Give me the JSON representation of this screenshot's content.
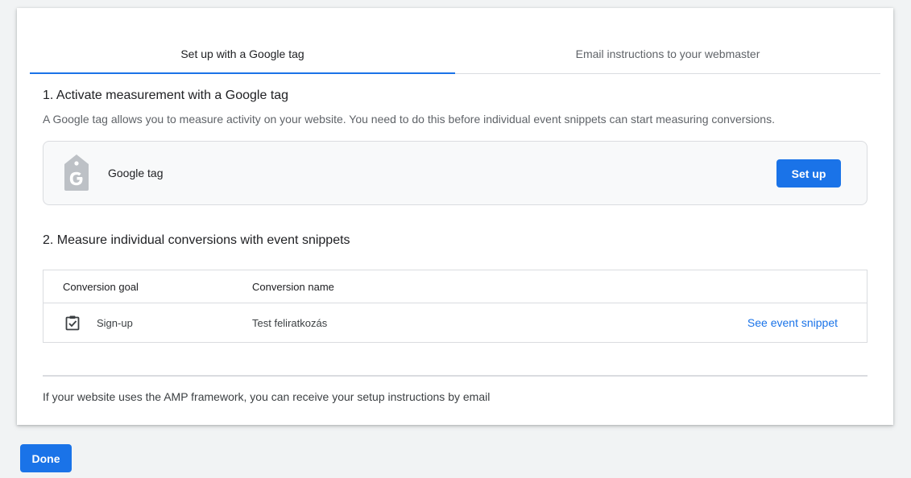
{
  "tabs": [
    {
      "label": "Set up with a Google tag",
      "active": true
    },
    {
      "label": "Email instructions to your webmaster",
      "active": false
    }
  ],
  "section1": {
    "heading": "1. Activate measurement with a Google tag",
    "description": "A Google tag allows you to measure activity on your website. You need to do this before individual event snippets can start measuring conversions.",
    "tag_label": "Google tag",
    "setup_label": "Set up",
    "icon": "google-tag-icon"
  },
  "section2": {
    "heading": "2. Measure individual conversions with event snippets",
    "columns": [
      "Conversion goal",
      "Conversion name"
    ],
    "rows": [
      {
        "goal": "Sign-up",
        "name": "Test feliratkozás",
        "action": "See event snippet",
        "icon": "clipboard-check-icon"
      }
    ]
  },
  "amp_text": "If your website uses the AMP framework, you can receive your setup instructions by email",
  "done_label": "Done",
  "colors": {
    "accent": "#1a73e8",
    "background": "#f1f3f4"
  }
}
